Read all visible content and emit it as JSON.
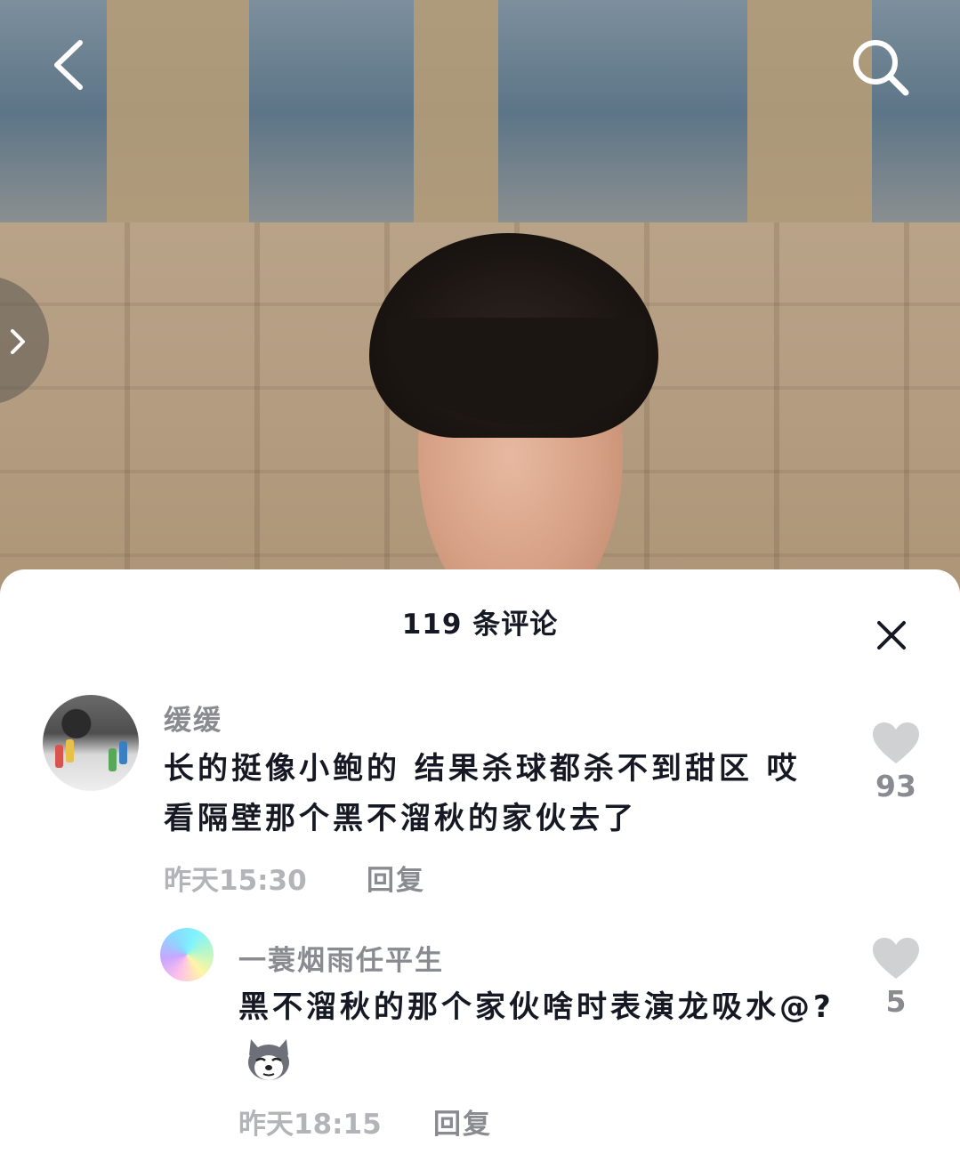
{
  "video": {
    "nav": {
      "back_icon": "chevron-left-icon",
      "search_icon": "search-icon",
      "side_handle_icon": "chevron-right-icon"
    }
  },
  "comments_panel": {
    "title": "119 条评论",
    "close_icon": "close-icon",
    "comments": [
      {
        "username": "缓缓",
        "text": "长的挺像小鲍的 结果杀球都杀不到甜区 哎 看隔壁那个黑不溜秋的家伙去了",
        "time": "昨天15:30",
        "reply_label": "回复",
        "likes": "93",
        "like_icon": "heart-icon"
      },
      {
        "username": "一蓑烟雨任平生",
        "text": "黑不溜秋的那个家伙啥时表演龙吸水@?",
        "emoji": "husky-emoji",
        "time": "昨天18:15",
        "reply_label": "回复",
        "likes": "5",
        "like_icon": "heart-icon"
      }
    ]
  },
  "colors": {
    "primary_text": "#161823",
    "secondary_text": "#8a8b91",
    "muted_text": "#b3b4b8",
    "icon_gray": "#d0d1d3"
  }
}
